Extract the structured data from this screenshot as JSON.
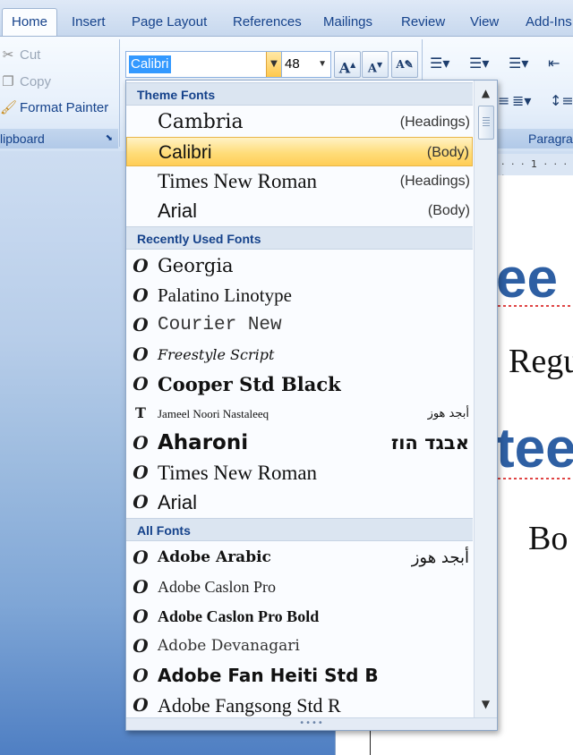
{
  "ribbon": {
    "tabs": [
      "Home",
      "Insert",
      "Page Layout",
      "References",
      "Mailings",
      "Review",
      "View",
      "Add-Ins"
    ],
    "clipboard": {
      "cut": "Cut",
      "copy": "Copy",
      "format_painter": "Format Painter",
      "group_label": "lipboard"
    },
    "font_name": "Calibri",
    "font_size": "48",
    "paragraph_label": "Paragra"
  },
  "document": {
    "big_text_1": "ee",
    "body_text_1": "Regu",
    "big_text_2": "tee",
    "body_text_2": "Bo",
    "ruler_marks": "· · · 1 · · · ·"
  },
  "font_dropdown": {
    "theme_header": "Theme Fonts",
    "theme_fonts": [
      {
        "name": "Cambria",
        "tag": "(Headings)"
      },
      {
        "name": "Calibri",
        "tag": "(Body)"
      },
      {
        "name": "Times New Roman",
        "tag": "(Headings)"
      },
      {
        "name": "Arial",
        "tag": "(Body)"
      }
    ],
    "recent_header": "Recently Used Fonts",
    "recent_fonts": [
      {
        "name": "Georgia",
        "sample": ""
      },
      {
        "name": "Palatino Linotype",
        "sample": ""
      },
      {
        "name": "Courier New",
        "sample": ""
      },
      {
        "name": "Freestyle Script",
        "sample": ""
      },
      {
        "name": "Cooper Std Black",
        "sample": ""
      },
      {
        "name": "Jameel Noori Nastaleeq",
        "sample": "أبجد هوز"
      },
      {
        "name": "Aharoni",
        "sample": "אבגד הוז"
      },
      {
        "name": "Times New Roman",
        "sample": ""
      },
      {
        "name": "Arial",
        "sample": ""
      }
    ],
    "all_header": "All Fonts",
    "all_fonts": [
      {
        "name": "Adobe Arabic",
        "sample": "أبجد هوز"
      },
      {
        "name": "Adobe Caslon Pro",
        "sample": ""
      },
      {
        "name": "Adobe Caslon Pro Bold",
        "sample": ""
      },
      {
        "name": "Adobe Devanagari",
        "sample": ""
      },
      {
        "name": "Adobe Fan Heiti Std B",
        "sample": ""
      },
      {
        "name": "Adobe Fangsong Std R",
        "sample": ""
      }
    ],
    "grip_dots": "••••"
  },
  "colors": {
    "accent": "#15428b",
    "selected_row": "#ffdd7a",
    "heading_blue": "#2e5fa3"
  },
  "icons": {
    "opentype": "O",
    "truetype": "T"
  }
}
